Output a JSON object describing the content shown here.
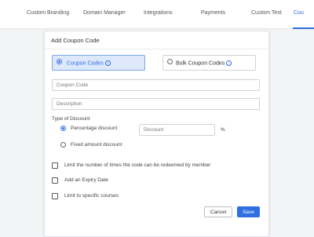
{
  "tabs": [
    {
      "label": "Custom Branding"
    },
    {
      "label": "Domain Manager"
    },
    {
      "label": "Integrations"
    },
    {
      "label": "Payments"
    },
    {
      "label": "Custom Text"
    },
    {
      "label": "Cou"
    }
  ],
  "active_tab_index": 5,
  "modal": {
    "title": "Add Coupon Code",
    "code_types": {
      "selected": "Coupon Codes",
      "options": [
        {
          "label": "Coupon Codes",
          "info_icon": "i"
        },
        {
          "label": "Bulk Coupon Codes",
          "info_icon": "i"
        }
      ]
    },
    "coupon_code": {
      "value": "",
      "placeholder": "Coupon Code"
    },
    "description": {
      "value": "",
      "placeholder": "Description"
    },
    "type_of_discount": {
      "label": "Type of Discount",
      "selected": "Percentage discount",
      "options": [
        {
          "label": "Percentage discount"
        },
        {
          "label": "Fixed amount discount"
        }
      ],
      "discount": {
        "value": "",
        "placeholder": "Discount",
        "unit": "%"
      }
    },
    "limits": [
      {
        "label": "Limit the number of times the code can be redeemed by member",
        "checked": false
      },
      {
        "label": "Add an Expiry Date",
        "checked": false
      },
      {
        "label": "Limit to specific courses",
        "checked": false
      }
    ],
    "buttons": {
      "cancel": "Cancel",
      "save": "Save"
    }
  },
  "colors": {
    "accent": "#2f6fe0",
    "selected_card_bg": "#dde9fb"
  }
}
